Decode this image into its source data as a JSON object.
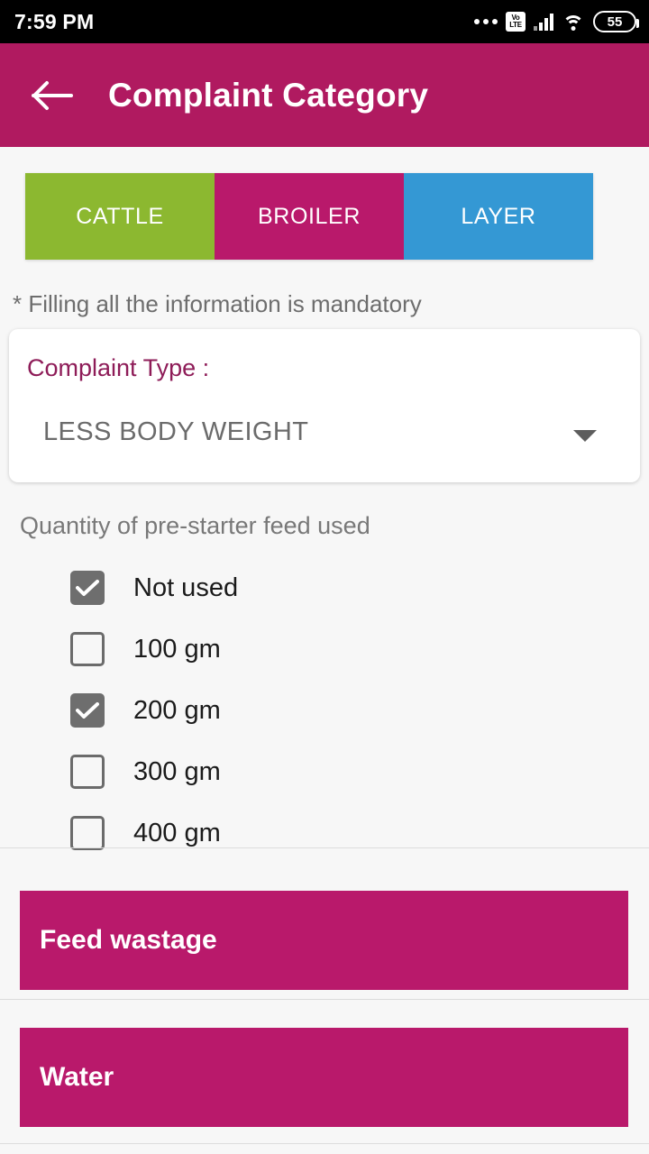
{
  "status_bar": {
    "time": "7:59 PM",
    "icons": [
      "more-dots-icon",
      "volte-icon",
      "signal-icon",
      "wifi-icon",
      "battery-icon"
    ],
    "volte_top": "Vo",
    "volte_bottom": "LTE",
    "battery_level": "55"
  },
  "app_bar": {
    "back_icon": "back-arrow-icon",
    "title": "Complaint Category",
    "color": "#b01a60"
  },
  "tabs": [
    {
      "label": "CATTLE",
      "color": "#8cb830"
    },
    {
      "label": "BROILER",
      "color": "#b9196b"
    },
    {
      "label": "LAYER",
      "color": "#3498d4"
    }
  ],
  "form": {
    "mandatory_note": "* Filling all the information is mandatory",
    "complaint_type": {
      "label": "Complaint Type :",
      "value": "LESS BODY WEIGHT",
      "caret_icon": "chevron-down-icon",
      "label_color": "#8e1c58"
    },
    "quantity_group": {
      "title": "Quantity of pre-starter feed used",
      "options": [
        {
          "label": "Not used",
          "checked": true
        },
        {
          "label": "100 gm",
          "checked": false
        },
        {
          "label": "200 gm",
          "checked": true
        },
        {
          "label": "300 gm",
          "checked": false
        },
        {
          "label": "400 gm",
          "checked": false
        }
      ]
    }
  },
  "sections": [
    {
      "label": "Feed wastage",
      "color": "#b9196b"
    },
    {
      "label": "Water",
      "color": "#b9196b"
    }
  ]
}
